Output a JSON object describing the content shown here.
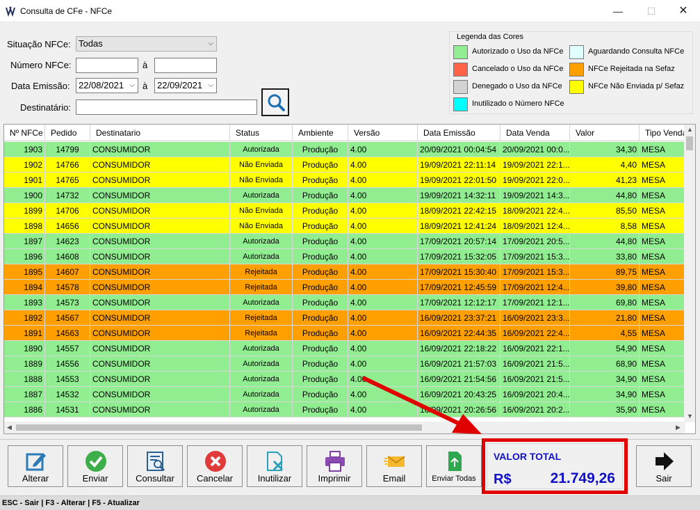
{
  "window": {
    "title": "Consulta de CFe - NFCe",
    "min": "—",
    "max": "☐",
    "close": "✕"
  },
  "filters": {
    "situacao_label": "Situação NFCe:",
    "situacao_value": "Todas",
    "numero_label": "Número NFCe:",
    "numero_from": "",
    "numero_sep": "à",
    "numero_to": "",
    "data_label": "Data Emissão:",
    "data_from": "22/08/2021",
    "data_sep": "à",
    "data_to": "22/09/2021",
    "destinatario_label": "Destinatário:",
    "destinatario_value": ""
  },
  "legend": {
    "title": "Legenda das Cores",
    "items": [
      {
        "label": "Autorizado o Uso da NFCe",
        "color": "#90ee90"
      },
      {
        "label": "Cancelado o Uso da NFCe",
        "color": "#ff6347"
      },
      {
        "label": "Denegado o Uso da NFCe",
        "color": "#d3d3d3"
      },
      {
        "label": "Inutilizado o Número NFCe",
        "color": "#00ffff"
      },
      {
        "label": "Aguardando Consulta NFCe",
        "color": "#e0ffff"
      },
      {
        "label": "NFCe Rejeitada na Sefaz",
        "color": "#ff9f00"
      },
      {
        "label": "NFCe Não Enviada p/ Sefaz",
        "color": "#ffff00"
      }
    ]
  },
  "grid": {
    "columns": [
      "Nº NFCe",
      "Pedido",
      "Destinatario",
      "Status",
      "Ambiente",
      "Versão",
      "Data Emissão",
      "Data Venda",
      "Valor",
      "Tipo Venda"
    ],
    "rows": [
      {
        "nfce": "1903",
        "pedido": "14799",
        "dest": "CONSUMIDOR",
        "status": "Autorizada",
        "ambiente": "Produção",
        "versao": "4.00",
        "emissao": "20/09/2021 00:04:54",
        "venda": "20/09/2021 00:0...",
        "valor": "34,30",
        "tipo": "MESA",
        "color": "#90ee90"
      },
      {
        "nfce": "1902",
        "pedido": "14766",
        "dest": "CONSUMIDOR",
        "status": "Não Enviada",
        "ambiente": "Produção",
        "versao": "4.00",
        "emissao": "19/09/2021 22:11:14",
        "venda": "19/09/2021 22:1...",
        "valor": "4,40",
        "tipo": "MESA",
        "color": "#ffff00"
      },
      {
        "nfce": "1901",
        "pedido": "14765",
        "dest": "CONSUMIDOR",
        "status": "Não Enviada",
        "ambiente": "Produção",
        "versao": "4.00",
        "emissao": "19/09/2021 22:01:50",
        "venda": "19/09/2021 22:0...",
        "valor": "41,23",
        "tipo": "MESA",
        "color": "#ffff00"
      },
      {
        "nfce": "1900",
        "pedido": "14732",
        "dest": "CONSUMIDOR",
        "status": "Autorizada",
        "ambiente": "Produção",
        "versao": "4.00",
        "emissao": "19/09/2021 14:32:11",
        "venda": "19/09/2021 14:3...",
        "valor": "44,80",
        "tipo": "MESA",
        "color": "#90ee90"
      },
      {
        "nfce": "1899",
        "pedido": "14706",
        "dest": "CONSUMIDOR",
        "status": "Não Enviada",
        "ambiente": "Produção",
        "versao": "4.00",
        "emissao": "18/09/2021 22:42:15",
        "venda": "18/09/2021 22:4...",
        "valor": "85,50",
        "tipo": "MESA",
        "color": "#ffff00"
      },
      {
        "nfce": "1898",
        "pedido": "14656",
        "dest": "CONSUMIDOR",
        "status": "Não Enviada",
        "ambiente": "Produção",
        "versao": "4.00",
        "emissao": "18/09/2021 12:41:24",
        "venda": "18/09/2021 12:4...",
        "valor": "8,58",
        "tipo": "MESA",
        "color": "#ffff00"
      },
      {
        "nfce": "1897",
        "pedido": "14623",
        "dest": "CONSUMIDOR",
        "status": "Autorizada",
        "ambiente": "Produção",
        "versao": "4.00",
        "emissao": "17/09/2021 20:57:14",
        "venda": "17/09/2021 20:5...",
        "valor": "44,80",
        "tipo": "MESA",
        "color": "#90ee90"
      },
      {
        "nfce": "1896",
        "pedido": "14608",
        "dest": "CONSUMIDOR",
        "status": "Autorizada",
        "ambiente": "Produção",
        "versao": "4.00",
        "emissao": "17/09/2021 15:32:05",
        "venda": "17/09/2021 15:3...",
        "valor": "33,80",
        "tipo": "MESA",
        "color": "#90ee90"
      },
      {
        "nfce": "1895",
        "pedido": "14607",
        "dest": "CONSUMIDOR",
        "status": "Rejeitada",
        "ambiente": "Produção",
        "versao": "4.00",
        "emissao": "17/09/2021 15:30:40",
        "venda": "17/09/2021 15:3...",
        "valor": "89,75",
        "tipo": "MESA",
        "color": "#ff9f00"
      },
      {
        "nfce": "1894",
        "pedido": "14578",
        "dest": "CONSUMIDOR",
        "status": "Rejeitada",
        "ambiente": "Produção",
        "versao": "4.00",
        "emissao": "17/09/2021 12:45:59",
        "venda": "17/09/2021 12:4...",
        "valor": "39,80",
        "tipo": "MESA",
        "color": "#ff9f00"
      },
      {
        "nfce": "1893",
        "pedido": "14573",
        "dest": "CONSUMIDOR",
        "status": "Autorizada",
        "ambiente": "Produção",
        "versao": "4.00",
        "emissao": "17/09/2021 12:12:17",
        "venda": "17/09/2021 12:1...",
        "valor": "69,80",
        "tipo": "MESA",
        "color": "#90ee90"
      },
      {
        "nfce": "1892",
        "pedido": "14567",
        "dest": "CONSUMIDOR",
        "status": "Rejeitada",
        "ambiente": "Produção",
        "versao": "4.00",
        "emissao": "16/09/2021 23:37:21",
        "venda": "16/09/2021 23:3...",
        "valor": "21,80",
        "tipo": "MESA",
        "color": "#ff9f00"
      },
      {
        "nfce": "1891",
        "pedido": "14563",
        "dest": "CONSUMIDOR",
        "status": "Rejeitada",
        "ambiente": "Produção",
        "versao": "4.00",
        "emissao": "16/09/2021 22:44:35",
        "venda": "16/09/2021 22:4...",
        "valor": "4,55",
        "tipo": "MESA",
        "color": "#ff9f00"
      },
      {
        "nfce": "1890",
        "pedido": "14557",
        "dest": "CONSUMIDOR",
        "status": "Autorizada",
        "ambiente": "Produção",
        "versao": "4.00",
        "emissao": "16/09/2021 22:18:22",
        "venda": "16/09/2021 22:1...",
        "valor": "54,90",
        "tipo": "MESA",
        "color": "#90ee90"
      },
      {
        "nfce": "1889",
        "pedido": "14556",
        "dest": "CONSUMIDOR",
        "status": "Autorizada",
        "ambiente": "Produção",
        "versao": "4.00",
        "emissao": "16/09/2021 21:57:03",
        "venda": "16/09/2021 21:5...",
        "valor": "68,90",
        "tipo": "MESA",
        "color": "#90ee90"
      },
      {
        "nfce": "1888",
        "pedido": "14553",
        "dest": "CONSUMIDOR",
        "status": "Autorizada",
        "ambiente": "Produção",
        "versao": "4.00",
        "emissao": "16/09/2021 21:54:56",
        "venda": "16/09/2021 21:5...",
        "valor": "34,90",
        "tipo": "MESA",
        "color": "#90ee90"
      },
      {
        "nfce": "1887",
        "pedido": "14532",
        "dest": "CONSUMIDOR",
        "status": "Autorizada",
        "ambiente": "Produção",
        "versao": "4.00",
        "emissao": "16/09/2021 20:43:25",
        "venda": "16/09/2021 20:4...",
        "valor": "34,90",
        "tipo": "MESA",
        "color": "#90ee90"
      },
      {
        "nfce": "1886",
        "pedido": "14531",
        "dest": "CONSUMIDOR",
        "status": "Autorizada",
        "ambiente": "Produção",
        "versao": "4.00",
        "emissao": "16/09/2021 20:26:56",
        "venda": "16/09/2021 20:2...",
        "valor": "35,90",
        "tipo": "MESA",
        "color": "#90ee90"
      }
    ]
  },
  "toolbar": {
    "buttons": [
      {
        "label": "Alterar",
        "icon": "edit-icon"
      },
      {
        "label": "Enviar",
        "icon": "check-icon"
      },
      {
        "label": "Consultar",
        "icon": "consult-icon"
      },
      {
        "label": "Cancelar",
        "icon": "cancel-icon"
      },
      {
        "label": "Inutilizar",
        "icon": "void-file-icon"
      },
      {
        "label": "Imprimir",
        "icon": "printer-icon"
      },
      {
        "label": "Email",
        "icon": "email-icon"
      },
      {
        "label": "Enviar Todas",
        "icon": "send-all-icon"
      }
    ],
    "exit_label": "Sair"
  },
  "total": {
    "label": "VALOR TOTAL",
    "currency": "R$",
    "value": "21.749,26"
  },
  "statusbar": {
    "text": "ESC - Sair | F3 - Alterar  |  F5 - Atualizar"
  },
  "colors": {
    "highlight": "#e00000",
    "total_text": "#1010c8"
  }
}
